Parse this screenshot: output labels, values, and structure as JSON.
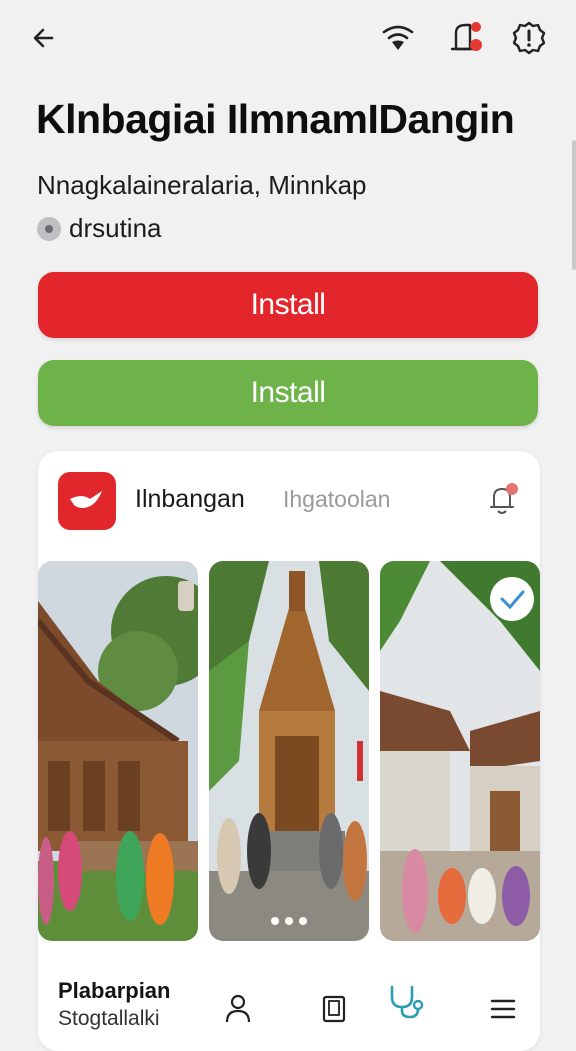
{
  "header": {
    "back_icon": "arrow-left-icon",
    "actions": [
      "wifi-icon",
      "notification-icon",
      "alert-gear-icon"
    ],
    "accent_dot_color": "#e53935"
  },
  "app": {
    "title": "Klnbagiai IlmnamIDangin",
    "subtitle": "Nnagkalaineralaria, Minnkap",
    "meta": "drsutina"
  },
  "buttons": {
    "primary_label": "Install",
    "secondary_label": "Install",
    "primary_color": "#e2262c",
    "secondary_color": "#6eb24a"
  },
  "card": {
    "app_name": "Ilnbangan",
    "category": "Ihgatoolan",
    "logo_icon": "bird-icon",
    "pager_dots": 3,
    "check_icon": "check-icon"
  },
  "bottom": {
    "label_primary": "Plabarpian",
    "label_secondary": "Stogtallalki",
    "nav_icons": [
      "person-icon",
      "phone-icon",
      "stethoscope-icon",
      "menu-icon"
    ]
  }
}
